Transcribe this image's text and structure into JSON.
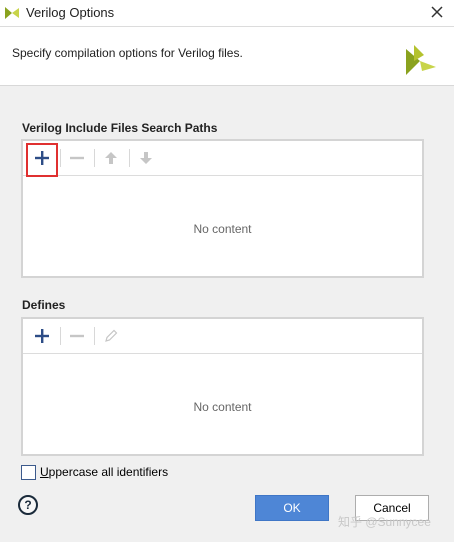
{
  "window": {
    "title": "Verilog Options",
    "close_icon": "close-icon"
  },
  "header": {
    "description": "Specify compilation options for Verilog files.",
    "logo_icon": "vivado-logo-icon"
  },
  "include_paths": {
    "label": "Verilog Include Files Search Paths",
    "toolbar": [
      "add-icon",
      "remove-icon",
      "move-up-icon",
      "move-down-icon"
    ],
    "empty_text": "No content",
    "highlight_color": "#e03030"
  },
  "defines": {
    "label": "Defines",
    "toolbar": [
      "add-icon",
      "remove-icon",
      "edit-icon"
    ],
    "empty_text": "No content"
  },
  "options": {
    "uppercase_accel": "U",
    "uppercase_rest": "ppercase all identifiers",
    "uppercase_checked": false
  },
  "footer": {
    "help_label": "?",
    "ok_label": "OK",
    "cancel_label": "Cancel"
  },
  "watermark": "知乎 @Sunnycee",
  "colors": {
    "accent": "#4e86d6",
    "logo_green": "#8aa21e"
  }
}
